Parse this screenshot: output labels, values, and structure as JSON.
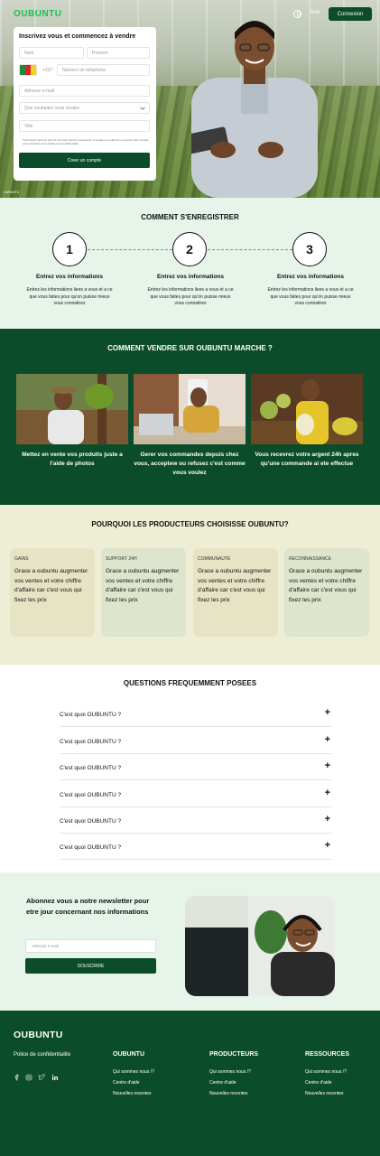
{
  "brand": {
    "name": "OUBUNTU",
    "accent": "#1bbf4f",
    "primary": "#0b4d2a"
  },
  "nav": {
    "aide": "Aide",
    "connexion": "Connexion"
  },
  "signup": {
    "title": "Inscrivez vous et commencez à vendre",
    "nom_placeholder": "Nom",
    "prenom_placeholder": "Prenom",
    "country_code": "+237",
    "phone_placeholder": "Numero de telephone",
    "email_placeholder": "Adresse e-mail",
    "sell_placeholder": "Que souhaitez vous vendre",
    "ville_placeholder": "Ville",
    "terms": "Vous devez avoir au plus 21 ans pour pouvoir commencer a vendre sur oubuntu en ouvrant votre compte vous acceptez nous politique de confidentialite",
    "submit": "Creer un compte"
  },
  "hero_credit": "OUBUNTU",
  "register": {
    "heading": "COMMENT S'ENREGISTRER",
    "steps": [
      {
        "num": "1",
        "title": "Entrez vos informations",
        "desc": "Entrez les informations liees a vous et a ce que vous faites pour qu'on puisse mieux vous connaitres"
      },
      {
        "num": "2",
        "title": "Entrez vos informations",
        "desc": "Entrez les informations liees a vous et a ce que vous faites pour qu'on puisse mieux vous connaitres"
      },
      {
        "num": "3",
        "title": "Entrez vos informations",
        "desc": "Entrez les informations liees a vous et a ce que vous faites pour qu'on puisse mieux vous connaitres"
      }
    ]
  },
  "sell": {
    "heading": "COMMENT VENDRE SUR OUBUNTU MARCHE ?",
    "items": [
      {
        "caption": "Mettez en vente vos produits juste a l'aide de photos"
      },
      {
        "caption": "Gerer vos commandes depuis chez vous, acceptew ou refusez c'est comme vous voulez"
      },
      {
        "caption": "Vous recevrez votre argent 24h apres qu'une commande ai ete effectue"
      }
    ]
  },
  "why": {
    "heading": "POURQUOI LES PRODUCTEURS CHOISISSE OUBUNTU?",
    "cards": [
      {
        "tag": "GAINS",
        "text": "Grace a oubuntu augmenter vos ventes et votre chiffre d'affaire car c'est vous qui fixez les prix",
        "color": "#e6e4c4"
      },
      {
        "tag": "SUPPORT 24H",
        "text": "Grace a oubuntu augmenter vos ventes et votre chiffre d'affaire car c'est vous qui fixez les prix",
        "color": "#dde6cc"
      },
      {
        "tag": "COMMUNAUTE",
        "text": "Grace a oubuntu augmenter vos ventes et votre chiffre d'affaire car c'est vous qui fixez les prix",
        "color": "#e6e4c4"
      },
      {
        "tag": "RECONNAISSANCE",
        "text": "Grace a oubuntu augmenter vos ventes et votre chiffre d'affaire car c'est vous qui fixez les prix",
        "color": "#dde6cc"
      }
    ]
  },
  "faq": {
    "heading": "QUESTIONS FREQUEMMENT POSEES",
    "items": [
      {
        "q": "C'est quoi OUBUNTU ?"
      },
      {
        "q": "C'est quoi OUBUNTU ?"
      },
      {
        "q": "C'est quoi OUBUNTU ?"
      },
      {
        "q": "C'est quoi OUBUNTU ?"
      },
      {
        "q": "C'est quoi OUBUNTU ?"
      },
      {
        "q": "C'est quoi OUBUNTU ?"
      }
    ],
    "plus": "+"
  },
  "newsletter": {
    "title": "Abonnez vous a notre newsletter pour etre jour concernant nos informations",
    "email_placeholder": "Adresse e-mail",
    "button": "SOUSCRIRE"
  },
  "footer": {
    "logo": "OUBUNTU",
    "policy": "Police de confidentialite",
    "social_icons": [
      "facebook-icon",
      "instagram-icon",
      "twitter-icon",
      "linkedin-icon"
    ],
    "columns": [
      {
        "head": "OUBUNTU",
        "links": [
          "Qui sommes nous /?",
          "Centre d'aide",
          "Nouvelles recentes"
        ]
      },
      {
        "head": "PRODUCTEURS",
        "links": [
          "Qui sommes nous /?",
          "Centre d'aide",
          "Nouvelles recentes"
        ]
      },
      {
        "head": "RESSOURCES",
        "links": [
          "Qui sommes nous /?",
          "Centre d'aide",
          "Nouvelles recentes"
        ]
      }
    ]
  }
}
